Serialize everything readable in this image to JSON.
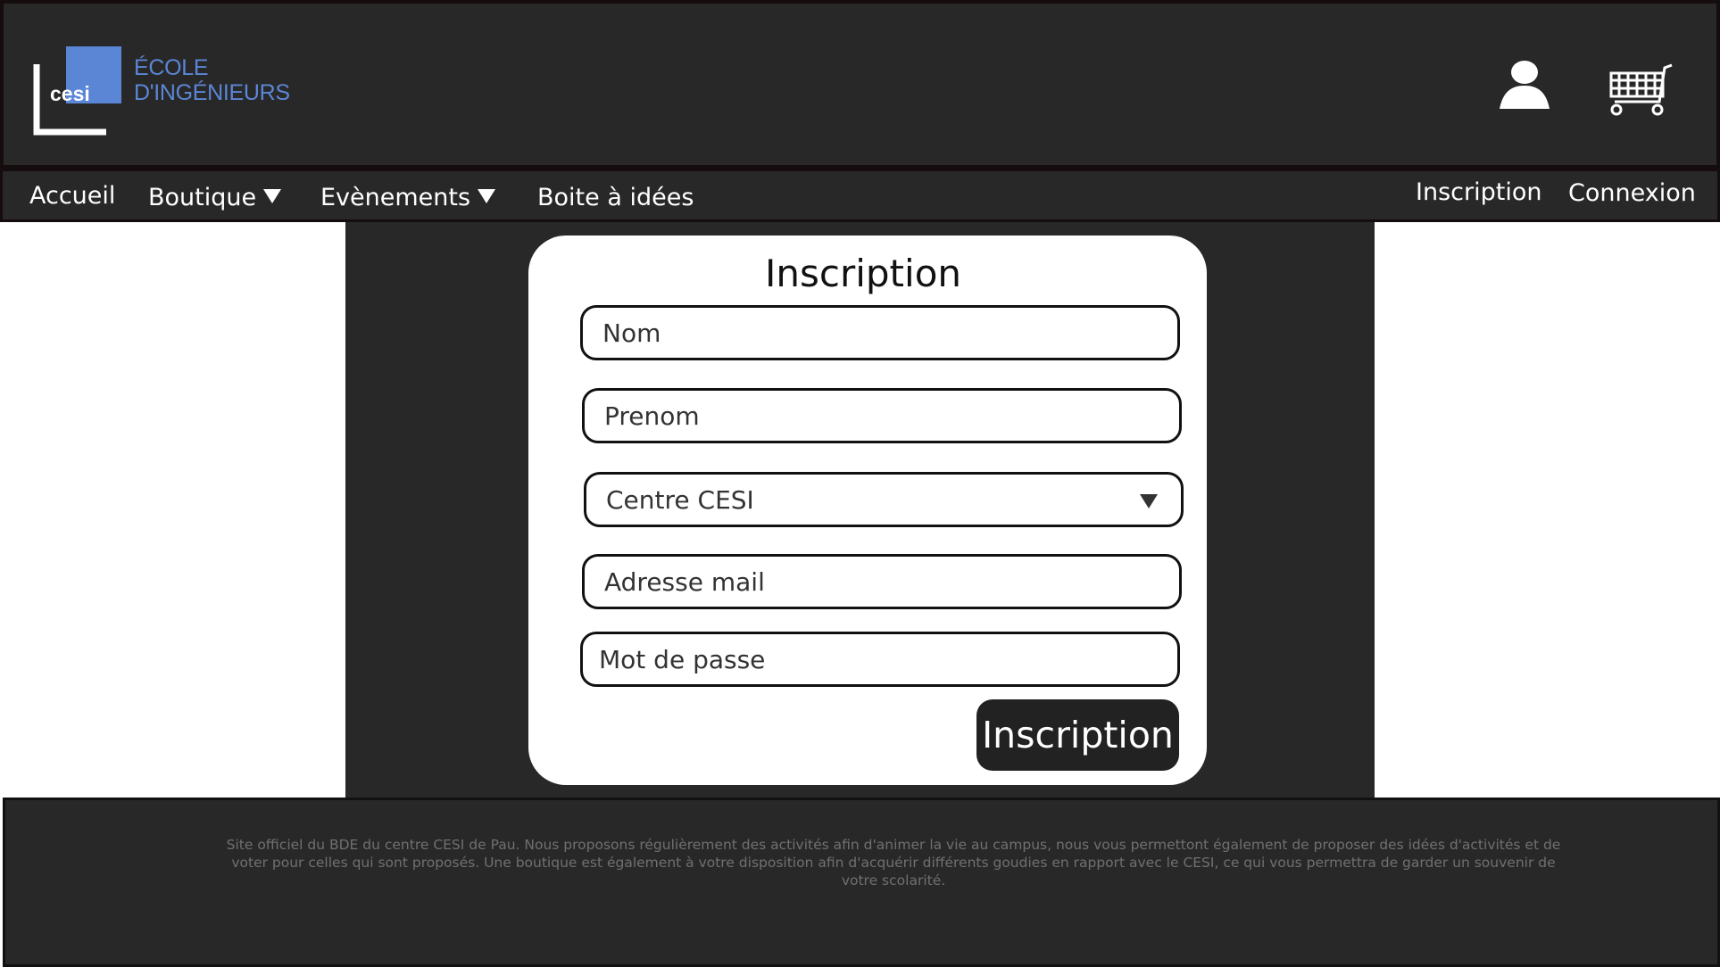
{
  "header": {
    "logo": {
      "brand": "cesi",
      "line1": "ÉCOLE",
      "line2": "D'INGÉNIEURS",
      "accent_color": "#5b86d6"
    },
    "icons": {
      "user": "user-icon",
      "cart": "shopping-cart-icon"
    }
  },
  "nav": {
    "left": [
      {
        "label": "Accueil"
      },
      {
        "label": "Boutique",
        "dropdown": true
      },
      {
        "label": "Evènements",
        "dropdown": true
      },
      {
        "label": "Boite à idées"
      }
    ],
    "right": [
      {
        "label": "Inscription"
      },
      {
        "label": "Connexion"
      }
    ]
  },
  "form": {
    "title": "Inscription",
    "fields": {
      "nom": {
        "placeholder": "Nom",
        "value": ""
      },
      "prenom": {
        "placeholder": "Prenom",
        "value": ""
      },
      "centre": {
        "selected": "Centre CESI"
      },
      "email": {
        "placeholder": "Adresse mail",
        "value": ""
      },
      "password": {
        "placeholder": "Mot de passe",
        "value": ""
      }
    },
    "submit_label": "Inscription"
  },
  "footer": {
    "text": "Site officiel du BDE du centre CESI de Pau. Nous proposons régulièrement des activités afin d'animer la vie au campus, nous vous permettont également de proposer des idées d'activités et de voter pour celles qui sont proposés. Une boutique est également à votre disposition afin d'acquérir différents goudies en rapport avec le CESI, ce qui vous permettra de garder un souvenir de votre scolarité."
  },
  "colors": {
    "dark_bg": "#282828",
    "page_bg": "#ffffff",
    "text_light": "#ffffff",
    "footer_text": "#707070"
  }
}
